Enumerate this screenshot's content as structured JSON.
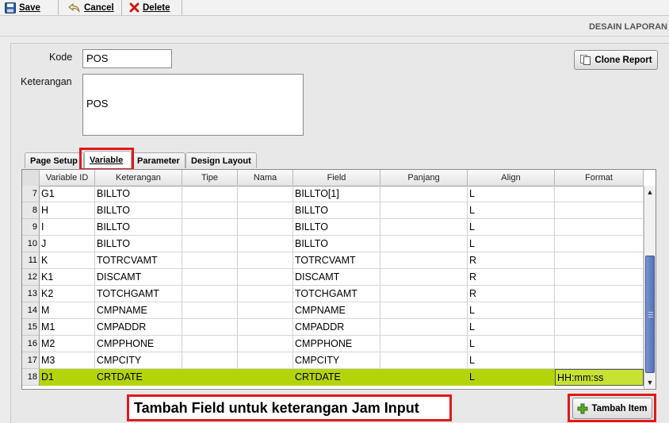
{
  "toolbar": {
    "save_label": "Save",
    "cancel_label": "Cancel",
    "delete_label": "Delete"
  },
  "window_title": "DESAIN LAPORAN",
  "form": {
    "kode_label": "Kode",
    "kode_value": "POS",
    "keterangan_label": "Keterangan",
    "keterangan_value": "POS"
  },
  "clone_button_label": "Clone Report",
  "tabs": [
    {
      "label": "Page Setup",
      "active": false
    },
    {
      "label": "Variable",
      "active": true
    },
    {
      "label": "Parameter",
      "active": false
    },
    {
      "label": "Design Layout",
      "active": false
    }
  ],
  "grid": {
    "columns": [
      "Variable ID",
      "Keterangan",
      "Tipe",
      "Nama",
      "Field",
      "Panjang",
      "Align",
      "Format"
    ],
    "rows": [
      {
        "n": "7",
        "cells": [
          "G1",
          "BILLTO",
          "",
          "",
          "BILLTO[1]",
          "",
          "L",
          ""
        ]
      },
      {
        "n": "8",
        "cells": [
          "H",
          "BILLTO",
          "",
          "",
          "BILLTO",
          "",
          "L",
          ""
        ]
      },
      {
        "n": "9",
        "cells": [
          "I",
          "BILLTO",
          "",
          "",
          "BILLTO",
          "",
          "L",
          ""
        ]
      },
      {
        "n": "10",
        "cells": [
          "J",
          "BILLTO",
          "",
          "",
          "BILLTO",
          "",
          "L",
          ""
        ]
      },
      {
        "n": "11",
        "cells": [
          "K",
          "TOTRCVAMT",
          "",
          "",
          "TOTRCVAMT",
          "",
          "R",
          ""
        ]
      },
      {
        "n": "12",
        "cells": [
          "K1",
          "DISCAMT",
          "",
          "",
          "DISCAMT",
          "",
          "R",
          ""
        ]
      },
      {
        "n": "13",
        "cells": [
          "K2",
          "TOTCHGAMT",
          "",
          "",
          "TOTCHGAMT",
          "",
          "R",
          ""
        ]
      },
      {
        "n": "14",
        "cells": [
          "M",
          "CMPNAME",
          "",
          "",
          "CMPNAME",
          "",
          "L",
          ""
        ]
      },
      {
        "n": "15",
        "cells": [
          "M1",
          "CMPADDR",
          "",
          "",
          "CMPADDR",
          "",
          "L",
          ""
        ]
      },
      {
        "n": "16",
        "cells": [
          "M2",
          "CMPPHONE",
          "",
          "",
          "CMPPHONE",
          "",
          "L",
          ""
        ]
      },
      {
        "n": "17",
        "cells": [
          "M3",
          "CMPCITY",
          "",
          "",
          "CMPCITY",
          "",
          "L",
          ""
        ]
      },
      {
        "n": "18",
        "cells": [
          "D1",
          "CRTDATE",
          "",
          "",
          "CRTDATE",
          "",
          "L",
          "HH:mm:ss"
        ],
        "selected": true
      }
    ]
  },
  "caption": "Tambah Field untuk keterangan Jam Input",
  "tambah_item_label": "Tambah Item",
  "colors": {
    "highlight_row": "#b4d40a",
    "annotation_red": "#e0191b",
    "scroll_thumb": "#5f7ac0"
  },
  "icons": {
    "save": "floppy-disk-icon",
    "cancel": "undo-arrow-icon",
    "delete": "red-x-icon",
    "clone": "document-copy-icon",
    "add": "green-plus-icon"
  }
}
